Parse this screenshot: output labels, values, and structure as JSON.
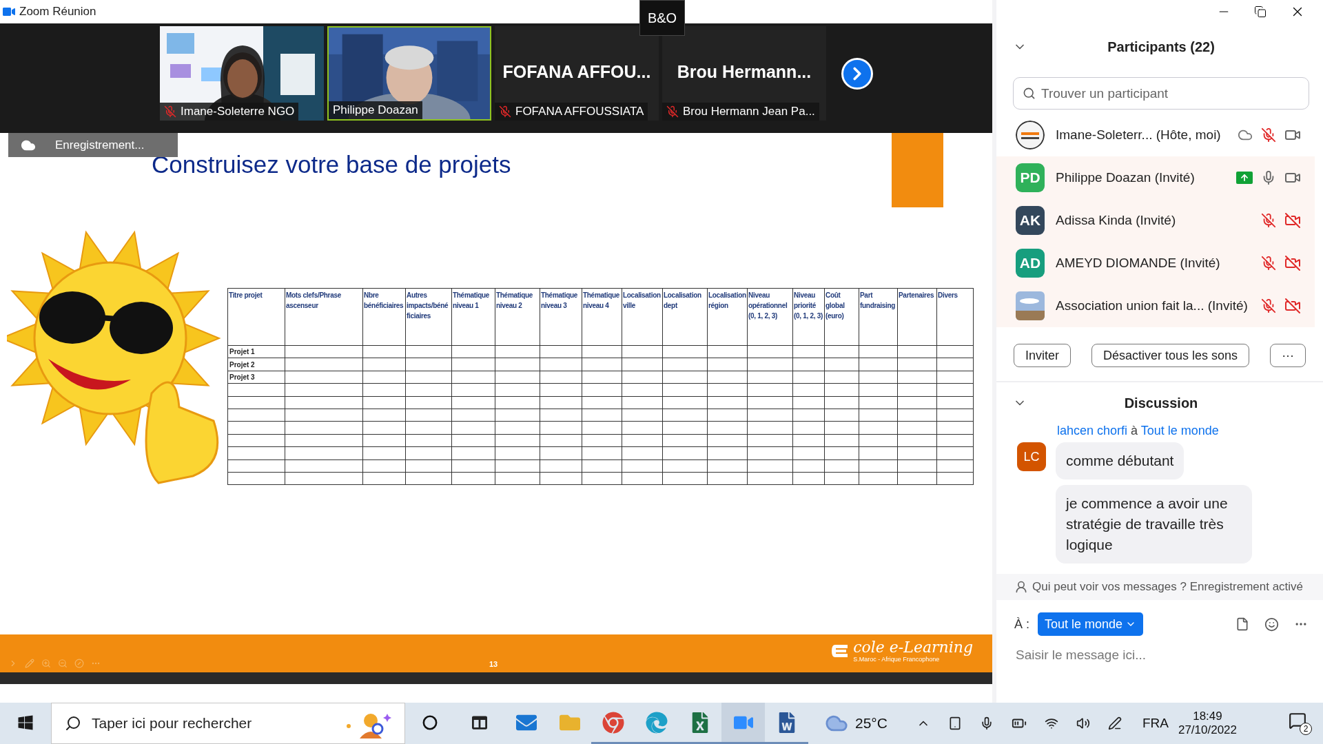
{
  "window": {
    "title": "Zoom Réunion",
    "logo_text": "B&O"
  },
  "video_strip": {
    "tiles": [
      {
        "kind": "video",
        "label": "Imane-Soleterre NGO",
        "muted": true,
        "selected": false
      },
      {
        "kind": "video",
        "label": "Philippe Doazan",
        "muted": false,
        "selected": true
      },
      {
        "kind": "name",
        "display_name": "FOFANA  AFFOU...",
        "label": "FOFANA AFFOUSSIATA",
        "muted": true,
        "selected": false
      },
      {
        "kind": "name",
        "display_name": "Brou  Hermann...",
        "label": "Brou Hermann Jean Pa...",
        "muted": true,
        "selected": false
      }
    ]
  },
  "recording_badge": "Enregistrement...",
  "slide": {
    "title": "Construisez votre base de projets",
    "page_number": "13",
    "logo": {
      "name": "cole e-Learning",
      "tagline": "S.Maroc - Afrique Francophone"
    },
    "table": {
      "columns": [
        "Titre projet",
        "Mots clefs/Phrase ascenseur",
        "Nbre bénéficiaires",
        "Autres impacts/béné ficiaires",
        "Thématique niveau 1",
        "Thématique niveau 2",
        "Thématique niveau 3",
        "Thématique niveau 4",
        "Localisation ville",
        "Localisation dept",
        "Localisation région",
        "Niveau opérationnel (0, 1, 2, 3)",
        "Niveau priorité (0, 1, 2, 3)",
        "Coût global (euro)",
        "Part fundraising",
        "Partenaires",
        "Divers"
      ],
      "rows": [
        {
          "title": "Projet 1"
        },
        {
          "title": "Projet 2"
        },
        {
          "title": "Projet 3"
        },
        {},
        {},
        {},
        {},
        {},
        {},
        {},
        {}
      ]
    }
  },
  "participants": {
    "title": "Participants (22)",
    "search_placeholder": "Trouver un participant",
    "items": [
      {
        "kind": "picture",
        "name": "Imane-Soleterr...  (Hôte, moi)",
        "recording": true,
        "sharing": false,
        "mic_muted": true,
        "video_off": false,
        "highlighted": false
      },
      {
        "kind": "initials",
        "initials": "PD",
        "color": "#2fb15a",
        "name": "Philippe Doazan (Invité)",
        "recording": false,
        "sharing": true,
        "mic_muted": false,
        "video_off": false,
        "highlighted": true
      },
      {
        "kind": "initials",
        "initials": "AK",
        "color": "#33475b",
        "name": "Adissa Kinda (Invité)",
        "recording": false,
        "sharing": false,
        "mic_muted": true,
        "video_off": true,
        "highlighted": true
      },
      {
        "kind": "initials",
        "initials": "AD",
        "color": "#179e7e",
        "name": "AMEYD DIOMANDE (Invité)",
        "recording": false,
        "sharing": false,
        "mic_muted": true,
        "video_off": true,
        "highlighted": true
      },
      {
        "kind": "picture",
        "name": "Association union fait la... (Invité)",
        "recording": false,
        "sharing": false,
        "mic_muted": true,
        "video_off": true,
        "highlighted": true
      }
    ],
    "buttons": [
      "Inviter",
      "Désactiver tous les sons",
      "···"
    ]
  },
  "discussion": {
    "title": "Discussion",
    "messages": [
      {
        "sender": "lahcen chorfi",
        "joiner": "à",
        "recipient": "Tout le monde",
        "initials": "LC",
        "color": "#d35400",
        "bubbles": [
          "comme débutant",
          "je commence a avoir une stratégie de travaille très logique"
        ]
      }
    ],
    "notice": "Qui peut voir vos messages ? Enregistrement activé",
    "to_label": "À :",
    "to_value": "Tout le monde",
    "input_placeholder": "Saisir le message ici..."
  },
  "taskbar": {
    "search_placeholder": "Taper ici pour rechercher",
    "weather": "25°C",
    "language": "FRA",
    "time": "18:49",
    "date": "27/10/2022",
    "notifications": "2"
  }
}
